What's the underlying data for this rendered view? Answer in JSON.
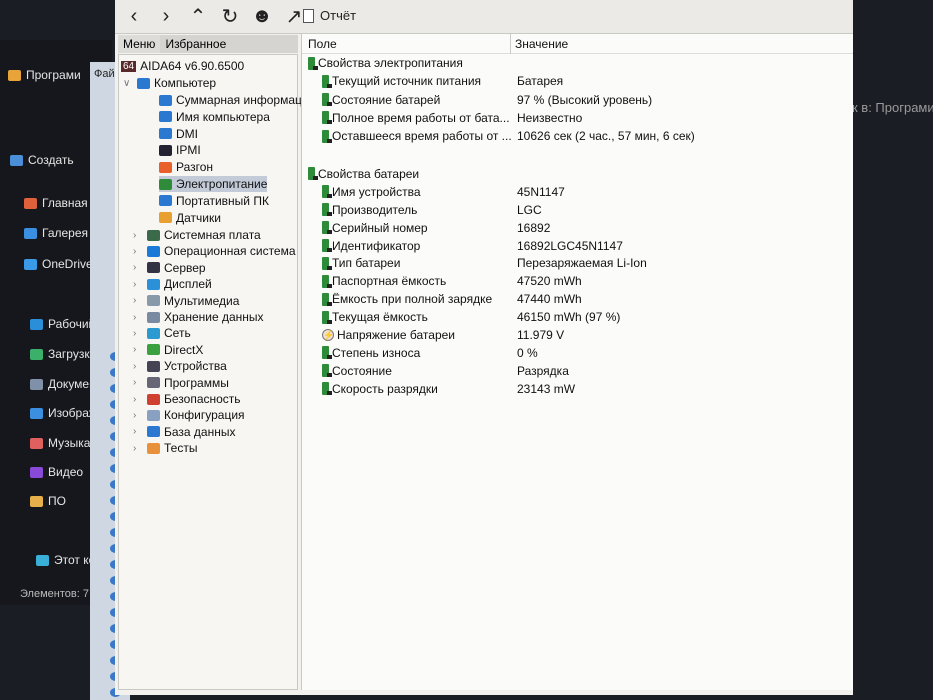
{
  "explorer": {
    "items": [
      {
        "label": "Програми",
        "color": "#e8a33a"
      },
      {
        "label": "Создать",
        "color": "#4a8fd8"
      },
      {
        "label": "Главная",
        "color": "#e0603a"
      },
      {
        "label": "Галерея",
        "color": "#3a8fe0"
      },
      {
        "label": "OneDrive",
        "color": "#3a9ae8"
      },
      {
        "label": "Рабочий",
        "color": "#2a8fd8"
      },
      {
        "label": "Загрузки",
        "color": "#3ab06a"
      },
      {
        "label": "Документ",
        "color": "#8090a8"
      },
      {
        "label": "Изображ",
        "color": "#3a8fe0"
      },
      {
        "label": "Музыка",
        "color": "#e06060"
      },
      {
        "label": "Видео",
        "color": "#8a4ad8"
      },
      {
        "label": "ПО",
        "color": "#e8b04a"
      },
      {
        "label": "Этот комп",
        "color": "#3ab0d8"
      }
    ],
    "status": "Элементов: 7"
  },
  "midwin": {
    "menu": "Фай"
  },
  "background_text": "к в: Програми",
  "toolbar": {
    "report_label": "Отчёт"
  },
  "tabs": {
    "menu": "Меню",
    "favorites": "Избранное"
  },
  "tree": {
    "root": "AIDA64 v6.90.6500",
    "root_badge": "64",
    "computer": "Компьютер",
    "computer_children": [
      "Суммарная информация",
      "Имя компьютера",
      "DMI",
      "IPMI",
      "Разгон",
      "Электропитание",
      "Портативный ПК",
      "Датчики"
    ],
    "selected": "Электропитание",
    "categories": [
      "Системная плата",
      "Операционная система",
      "Сервер",
      "Дисплей",
      "Мультимедиа",
      "Хранение данных",
      "Сеть",
      "DirectX",
      "Устройства",
      "Программы",
      "Безопасность",
      "Конфигурация",
      "База данных",
      "Тесты"
    ]
  },
  "list": {
    "columns": {
      "field": "Поле",
      "value": "Значение"
    },
    "groups": [
      {
        "title": "Свойства электропитания",
        "rows": [
          {
            "field": "Текущий источник питания",
            "value": "Батарея"
          },
          {
            "field": "Состояние батарей",
            "value": "97 % (Высокий уровень)"
          },
          {
            "field": "Полное время работы от бата...",
            "value": "Неизвестно"
          },
          {
            "field": "Оставшееся время работы от ...",
            "value": "10626 сек (2 час., 57 мин, 6 сек)"
          }
        ]
      },
      {
        "title": "Свойства батареи",
        "rows": [
          {
            "field": "Имя устройства",
            "value": "45N1147"
          },
          {
            "field": "Производитель",
            "value": "LGC"
          },
          {
            "field": "Серийный номер",
            "value": "16892"
          },
          {
            "field": "Идентификатор",
            "value": "16892LGC45N1147"
          },
          {
            "field": "Тип батареи",
            "value": "Перезаряжаемая Li-Ion"
          },
          {
            "field": "Паспортная ёмкость",
            "value": "47520 mWh"
          },
          {
            "field": "Ёмкость при полной зарядке",
            "value": "47440 mWh"
          },
          {
            "field": "Текущая ёмкость",
            "value": "46150 mWh  (97 %)"
          },
          {
            "field": "Напряжение батареи",
            "value": "11.979 V"
          },
          {
            "field": "Степень износа",
            "value": "0 %"
          },
          {
            "field": "Состояние",
            "value": "Разрядка"
          },
          {
            "field": "Скорость разрядки",
            "value": "23143 mW"
          }
        ]
      }
    ]
  }
}
